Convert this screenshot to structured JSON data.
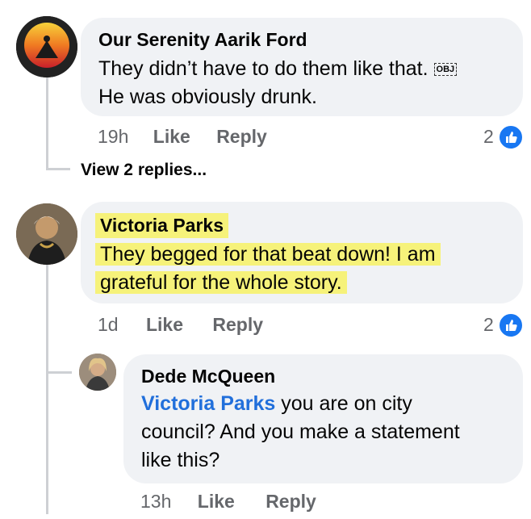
{
  "comments": [
    {
      "author": "Our Serenity Aarik Ford",
      "text_line1": "They didn’t have to do them like that.",
      "obj_badge": "OBJ",
      "text_line2": "He was obviously drunk.",
      "time": "19h",
      "like_label": "Like",
      "reply_label": "Reply",
      "reaction_count": "2",
      "view_replies": "View 2 replies..."
    },
    {
      "author": "Victoria Parks",
      "text_line1": "They begged for that beat down! I am",
      "text_line2": "grateful for the whole story.",
      "time": "1d",
      "like_label": "Like",
      "reply_label": "Reply",
      "reaction_count": "2"
    }
  ],
  "reply": {
    "author": "Dede McQueen",
    "mention": "Victoria Parks",
    "text_line1": " you are on city",
    "text_line2": "council? And you make a statement",
    "text_line3": "like this?",
    "time": "13h",
    "like_label": "Like",
    "reply_label": "Reply"
  },
  "colors": {
    "bubble": "#f0f2f5",
    "meta": "#65676b",
    "link": "#216fdb",
    "like_blue": "#1877f2",
    "highlight": "#f6f27a"
  }
}
